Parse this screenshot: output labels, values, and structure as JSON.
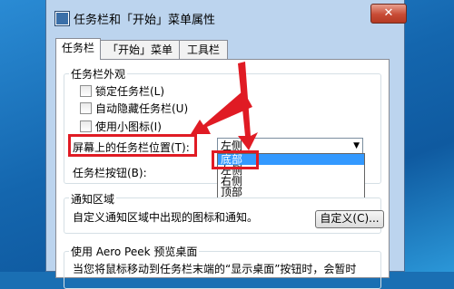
{
  "window": {
    "title": "任务栏和「开始」菜单属性",
    "close_label": "✕"
  },
  "tabs": [
    {
      "label": "任务栏",
      "active": true
    },
    {
      "label": "「开始」菜单",
      "active": false
    },
    {
      "label": "工具栏",
      "active": false
    }
  ],
  "appearance": {
    "group_label": "任务栏外观",
    "checkboxes": [
      {
        "label": "锁定任务栏(L)",
        "checked": false
      },
      {
        "label": "自动隐藏任务栏(U)",
        "checked": false
      },
      {
        "label": "使用小图标(I)",
        "checked": false
      }
    ],
    "position_label": "屏幕上的任务栏位置(T):",
    "position_value": "左侧",
    "position_options": [
      "底部",
      "左侧",
      "右侧",
      "顶部"
    ],
    "position_highlighted": "底部",
    "buttons_label": "任务栏按钮(B):"
  },
  "notification": {
    "group_label": "通知区域",
    "description": "自定义通知区域中出现的图标和通知。",
    "customize_button": "自定义(C)..."
  },
  "aero_peek": {
    "group_label": "使用 Aero Peek 预览桌面",
    "description": "当您将鼠标移动到任务栏末端的“显示桌面”按钮时，会暂时"
  },
  "annotation_color": "#e01b24"
}
